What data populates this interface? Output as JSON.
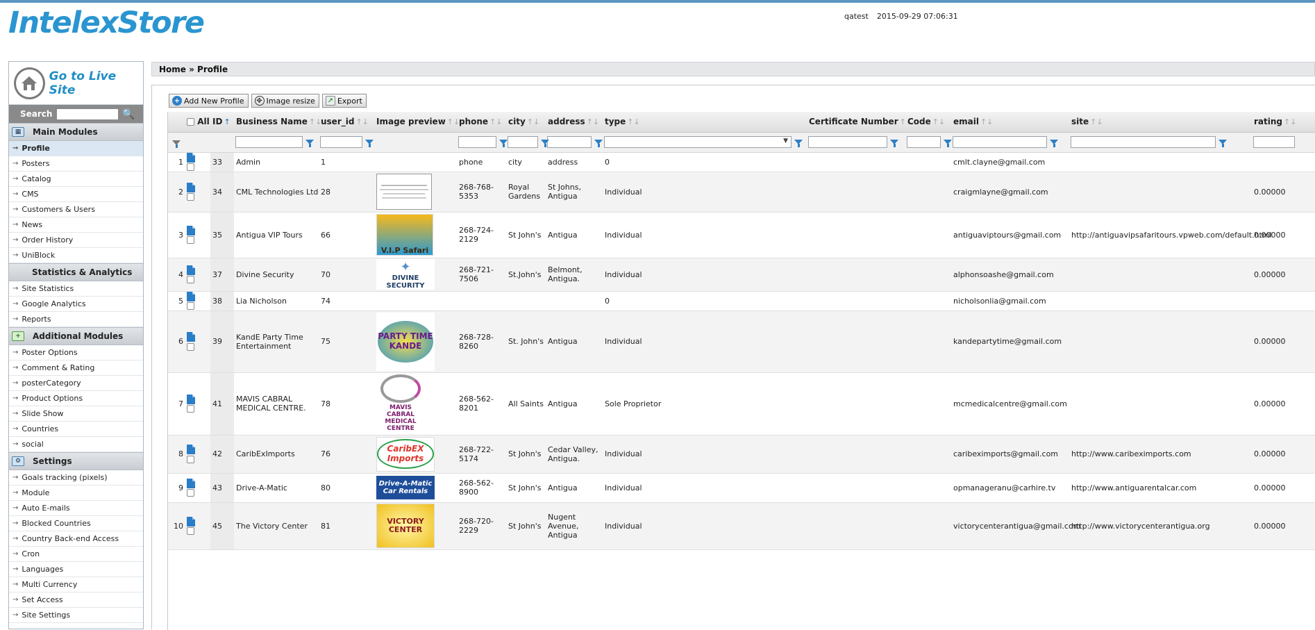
{
  "header": {
    "logo": "IntelexStore",
    "username": "qatest",
    "datetime": "2015-09-29 07:06:31"
  },
  "sidebar": {
    "go_live": "Go to Live Site",
    "search_label": "Search",
    "search_value": "",
    "main_title": "Main Modules",
    "main_items": [
      "Profile",
      "Posters",
      "Catalog",
      "CMS",
      "Customers & Users",
      "News",
      "Order History",
      "UniBlock"
    ],
    "stats_title": "Statistics & Analytics",
    "stats_items": [
      "Site Statistics",
      "Google Analytics",
      "Reports"
    ],
    "additional_title": "Additional Modules",
    "additional_items": [
      "Poster Options",
      "Comment & Rating",
      "posterCategory",
      "Product Options",
      "Slide Show",
      "Countries",
      "social"
    ],
    "settings_title": "Settings",
    "settings_items": [
      "Goals tracking (pixels)",
      "Module",
      "Auto E-mails",
      "Blocked Countries",
      "Country Back-end Access",
      "Cron",
      "Languages",
      "Multi Currency",
      "Set Access",
      "Site Settings"
    ]
  },
  "breadcrumb": "Home » Profile",
  "toolbar": {
    "add": "Add New Profile",
    "resize": "Image resize",
    "export": "Export"
  },
  "columns": {
    "all": "All",
    "id": "ID",
    "business": "Business Name",
    "user_id": "user_id",
    "image": "Image preview",
    "phone": "phone",
    "city": "city",
    "address": "address",
    "type": "type",
    "cert": "Certificate Number",
    "code": "Code",
    "email": "email",
    "site": "site",
    "rating": "rating"
  },
  "rows": [
    {
      "n": "1",
      "id": "33",
      "business": "Admin",
      "user_id": "1",
      "image": "",
      "phone": "phone",
      "city": "city",
      "address": "address",
      "type": "0",
      "email": "cmlt.clayne@gmail.com",
      "site": "",
      "rating": ""
    },
    {
      "n": "2",
      "id": "34",
      "business": "CML Technologies Ltd",
      "user_id": "28",
      "image": "CML",
      "phone": "268-768-5353",
      "city": "Royal Gardens",
      "address": "St Johns, Antigua",
      "type": "Individual",
      "email": "craigmlayne@gmail.com",
      "site": "",
      "rating": "0.00000"
    },
    {
      "n": "3",
      "id": "35",
      "business": "Antigua VIP Tours",
      "user_id": "66",
      "image": "VIP",
      "phone": "268-724-2129",
      "city": "St John's",
      "address": "Antigua",
      "type": "Individual",
      "email": "antiguaviptours@gmail.com",
      "site": "http://antiguavipsafaritours.vpweb.com/default.html",
      "rating": "0.00000"
    },
    {
      "n": "4",
      "id": "37",
      "business": "Divine Security",
      "user_id": "70",
      "image": "DIVINE",
      "phone": "268-721-7506",
      "city": "St.John's",
      "address": "Belmont, Antigua.",
      "type": "Individual",
      "email": "alphonsoashe@gmail.com",
      "site": "",
      "rating": "0.00000"
    },
    {
      "n": "5",
      "id": "38",
      "business": "Lia Nicholson",
      "user_id": "74",
      "image": "",
      "phone": "",
      "city": "",
      "address": "",
      "type": "0",
      "email": "nicholsonlia@gmail.com",
      "site": "",
      "rating": ""
    },
    {
      "n": "6",
      "id": "39",
      "business": "KandE Party Time Entertainment",
      "user_id": "75",
      "image": "KANDE",
      "phone": "268-728-8260",
      "city": "St. John's",
      "address": "Antigua",
      "type": "Individual",
      "email": "kandepartytime@gmail.com",
      "site": "",
      "rating": "0.00000"
    },
    {
      "n": "7",
      "id": "41",
      "business": "MAVIS CABRAL MEDICAL CENTRE.",
      "user_id": "78",
      "image": "MAVIS",
      "phone": "268-562-8201",
      "city": "All Saints",
      "address": "Antigua",
      "type": "Sole Proprietor",
      "email": "mcmedicalcentre@gmail.com",
      "site": "",
      "rating": "0.00000"
    },
    {
      "n": "8",
      "id": "42",
      "business": "CaribExImports",
      "user_id": "76",
      "image": "CARIBEX",
      "phone": "268-722-5174",
      "city": "St John's",
      "address": "Cedar Valley, Antigua.",
      "type": "Individual",
      "email": "caribeximports@gmail.com",
      "site": "http://www.caribeximports.com",
      "rating": "0.00000"
    },
    {
      "n": "9",
      "id": "43",
      "business": "Drive-A-Matic",
      "user_id": "80",
      "image": "DRIVE",
      "phone": "268-562-8900",
      "city": "St John's",
      "address": "Antigua",
      "type": "Individual",
      "email": "opmanageranu@carhire.tv",
      "site": "http://www.antiguarentalcar.com",
      "rating": "0.00000"
    },
    {
      "n": "10",
      "id": "45",
      "business": "The Victory Center",
      "user_id": "81",
      "image": "VICTORY",
      "phone": "268-720-2229",
      "city": "St John's",
      "address": "Nugent Avenue, Antigua",
      "type": "Individual",
      "email": "victorycenterantigua@gmail.com",
      "site": "http://www.victorycenterantigua.org",
      "rating": "0.00000"
    }
  ],
  "logo_texts": {
    "VIP": "V.I.P Safari",
    "DIVINE": "DIVINE SECURITY",
    "KANDE": "PARTY TIME KANDE",
    "MAVIS": "MAVIS CABRAL MEDICAL CENTRE",
    "CARIBEX": "CaribEX Imports",
    "DRIVE": "Drive-A-Matic Car Rentals",
    "VICTORY": "VICTORY CENTER"
  },
  "colors": {
    "logo_blue": "#2a95d0",
    "filter_blue": "#2d7fc4",
    "accent": "#5b97c2"
  }
}
